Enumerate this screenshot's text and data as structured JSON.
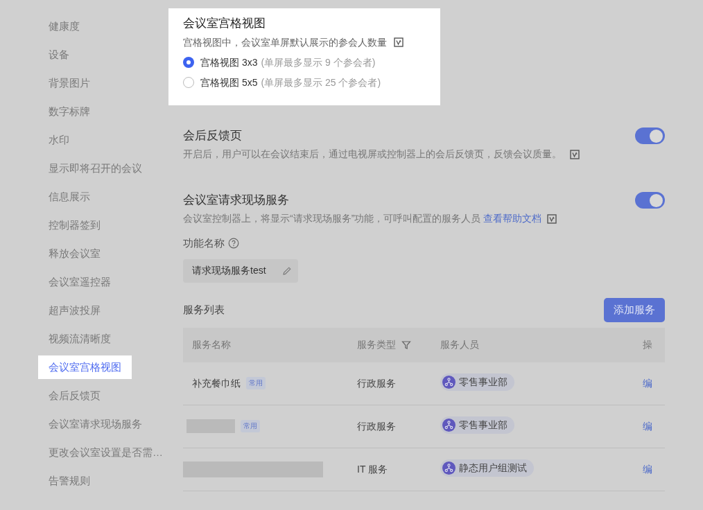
{
  "sidebar": {
    "items": [
      {
        "label": "健康度",
        "selected": false
      },
      {
        "label": "设备",
        "selected": false
      },
      {
        "label": "背景图片",
        "selected": false
      },
      {
        "label": "数字标牌",
        "selected": false
      },
      {
        "label": "水印",
        "selected": false
      },
      {
        "label": "显示即将召开的会议",
        "selected": false
      },
      {
        "label": "信息展示",
        "selected": false
      },
      {
        "label": "控制器签到",
        "selected": false
      },
      {
        "label": "释放会议室",
        "selected": false
      },
      {
        "label": "会议室遥控器",
        "selected": false
      },
      {
        "label": "超声波投屏",
        "selected": false
      },
      {
        "label": "视频流清晰度",
        "selected": false
      },
      {
        "label": "会议室宫格视图",
        "selected": true
      },
      {
        "label": "会后反馈页",
        "selected": false
      },
      {
        "label": "会议室请求现场服务",
        "selected": false
      },
      {
        "label": "更改会议室设置是否需…",
        "selected": false
      },
      {
        "label": "告警规则",
        "selected": false
      }
    ]
  },
  "grid_view": {
    "title": "会议室宫格视图",
    "description": "宫格视图中，会议室单屏默认展示的参会人数量",
    "options": [
      {
        "label": "宫格视图 3x3",
        "hint": "(单屏最多显示 9 个参会者)",
        "selected": true
      },
      {
        "label": "宫格视图 5x5",
        "hint": "(单屏最多显示 25 个参会者)",
        "selected": false
      }
    ]
  },
  "feedback": {
    "title": "会后反馈页",
    "description": "开启后，用户可以在会议结束后，通过电视屏或控制器上的会后反馈页，反馈会议质量。",
    "on": true
  },
  "onsite_service": {
    "title": "会议室请求现场服务",
    "description": "会议室控制器上，将显示“请求现场服务”功能，可呼叫配置的服务人员",
    "link": "查看帮助文档",
    "on": true,
    "name_label": "功能名称",
    "name_value": "请求现场服务test",
    "list_title": "服务列表",
    "add_button": "添加服务",
    "table": {
      "columns": [
        {
          "label": "服务名称",
          "filter": false
        },
        {
          "label": "服务类型",
          "filter": true
        },
        {
          "label": "服务人员",
          "filter": false
        },
        {
          "label": "操",
          "filter": false
        }
      ],
      "rows": [
        {
          "kind": "text",
          "name": "补充餐巾纸",
          "tag": "常用",
          "type": "行政服务",
          "staff": "零售事业部",
          "action": "编"
        },
        {
          "kind": "redacted",
          "tag": "常用",
          "type": "行政服务",
          "staff": "零售事业部",
          "action": "编"
        },
        {
          "kind": "redacted",
          "type": "IT 服务",
          "staff": "静态用户组测试",
          "action": "编"
        }
      ]
    }
  }
}
